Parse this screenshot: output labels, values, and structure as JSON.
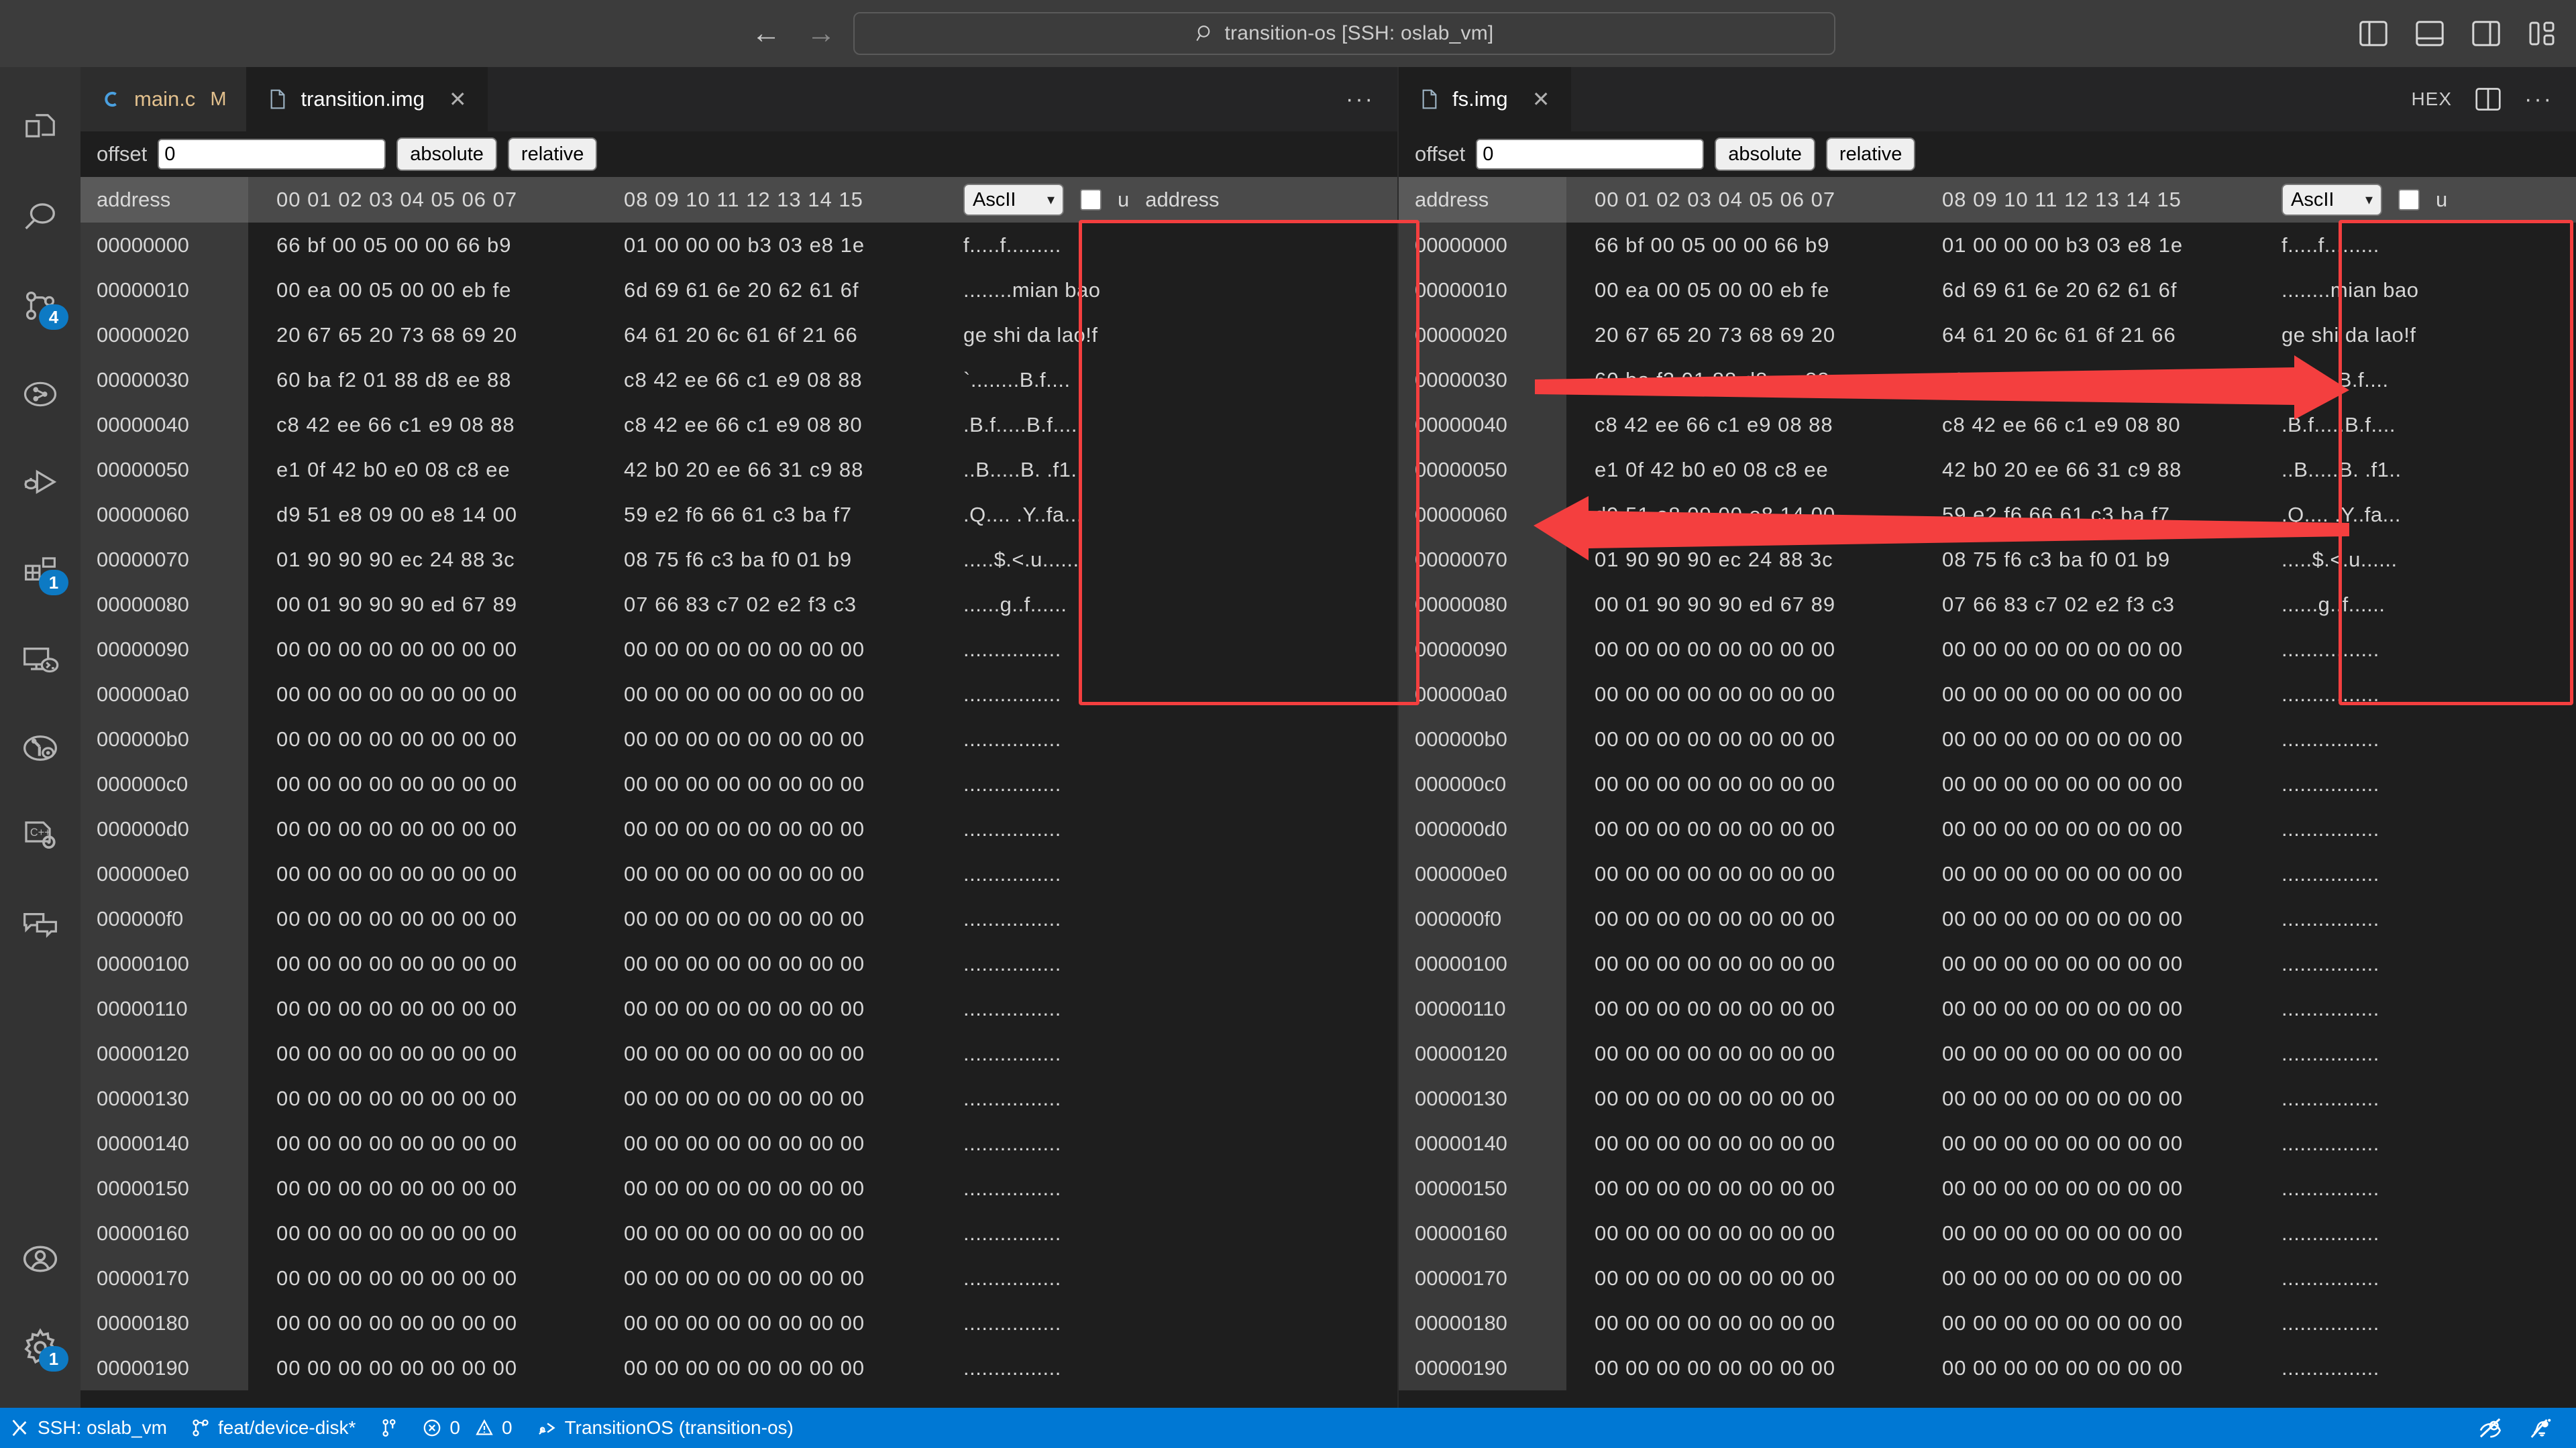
{
  "titlebar": {
    "back_label": "←",
    "forward_label": "→",
    "command_center_text": "transition-os [SSH: oslab_vm]",
    "layout_buttons": [
      {
        "name": "toggle-primary-sidebar",
        "label": "Toggle Primary Side Bar"
      },
      {
        "name": "toggle-panel",
        "label": "Toggle Panel"
      },
      {
        "name": "toggle-secondary-sidebar",
        "label": "Toggle Secondary Side Bar"
      },
      {
        "name": "customize-layout",
        "label": "Customize Layout"
      }
    ]
  },
  "activitybar": {
    "items": [
      {
        "name": "explorer",
        "label": "Explorer",
        "badge": ""
      },
      {
        "name": "search",
        "label": "Search",
        "badge": ""
      },
      {
        "name": "source-control",
        "label": "Source Control",
        "badge": "4"
      },
      {
        "name": "run",
        "label": "Run and Debug",
        "badge": ""
      },
      {
        "name": "debug-launch",
        "label": "Debug",
        "badge": ""
      },
      {
        "name": "extensions",
        "label": "Extensions",
        "badge": "1"
      },
      {
        "name": "remote-explorer",
        "label": "Remote Explorer",
        "badge": ""
      },
      {
        "name": "testing",
        "label": "Testing",
        "badge": ""
      },
      {
        "name": "cpp-config",
        "label": "C/C++ Configuration",
        "badge": ""
      },
      {
        "name": "chat",
        "label": "Chat",
        "badge": ""
      }
    ],
    "bottom_items": [
      {
        "name": "accounts",
        "label": "Accounts",
        "badge": ""
      },
      {
        "name": "settings",
        "label": "Manage",
        "badge": "1"
      }
    ]
  },
  "left_group": {
    "tabs": [
      {
        "name": "main-c",
        "label": "main.c",
        "badge": "M",
        "icon": "c-file-icon",
        "active": false,
        "closable": false
      },
      {
        "name": "transition-img",
        "label": "transition.img",
        "badge": "",
        "icon": "file-icon",
        "active": true,
        "closable": true
      }
    ],
    "actions": {
      "more": "···"
    },
    "offsetbar": {
      "label": "offset",
      "value": "0",
      "placeholder": "0",
      "absolute_label": "absolute",
      "relative_label": "relative"
    },
    "columns": {
      "address": "address",
      "hex_a": "00 01 02 03 04 05 06 07",
      "hex_b": "08 09 10 11 12 13 14 15",
      "encoding_selected": "AscII",
      "encoding_options": [
        "AscII"
      ],
      "unicode_checkbox_label": "u",
      "unicode_checked": false,
      "second_address_label": "address"
    }
  },
  "right_group": {
    "tabs": [
      {
        "name": "fs-img",
        "label": "fs.img",
        "badge": "",
        "icon": "file-icon",
        "active": true,
        "closable": true
      }
    ],
    "actions": {
      "hex": "HEX",
      "split": "split-editor-icon",
      "more": "···"
    },
    "offsetbar": {
      "label": "offset",
      "value": "0",
      "placeholder": "0",
      "absolute_label": "absolute",
      "relative_label": "relative"
    },
    "columns": {
      "address": "address",
      "hex_a": "00 01 02 03 04 05 06 07",
      "hex_b": "08 09 10 11 12 13 14 15",
      "encoding_selected": "AscII",
      "encoding_options": [
        "AscII"
      ],
      "unicode_checkbox_label": "u",
      "unicode_checked": false
    }
  },
  "hex_rows": [
    {
      "address": "00000000",
      "a": "66 bf 00 05 00 00 66 b9",
      "b": "01 00 00 00 b3 03 e8 1e",
      "ascii": "f.....f........."
    },
    {
      "address": "00000010",
      "a": "00 ea 00 05 00 00 eb fe",
      "b": "6d 69 61 6e 20 62 61 6f",
      "ascii": "........mian bao"
    },
    {
      "address": "00000020",
      "a": "20 67 65 20 73 68 69 20",
      "b": "64 61 20 6c 61 6f 21 66",
      "ascii": "ge shi da lao!f"
    },
    {
      "address": "00000030",
      "a": "60 ba f2 01 88 d8 ee 88",
      "b": "c8 42 ee 66 c1 e9 08 88",
      "ascii": "`........B.f...."
    },
    {
      "address": "00000040",
      "a": "c8 42 ee 66 c1 e9 08 88",
      "b": "c8 42 ee 66 c1 e9 08 80",
      "ascii": ".B.f.....B.f...."
    },
    {
      "address": "00000050",
      "a": "e1 0f 42 b0 e0 08 c8 ee",
      "b": "42 b0 20 ee 66 31 c9 88",
      "ascii": "..B.....B. .f1.."
    },
    {
      "address": "00000060",
      "a": "d9 51 e8 09 00 e8 14 00",
      "b": "59 e2 f6 66 61 c3 ba f7",
      "ascii": ".Q.... .Y..fa..."
    },
    {
      "address": "00000070",
      "a": "01 90 90 90 ec 24 88 3c",
      "b": "08 75 f6 c3 ba f0 01 b9",
      "ascii": ".....$.<.u......"
    },
    {
      "address": "00000080",
      "a": "00 01 90 90 90 ed 67 89",
      "b": "07 66 83 c7 02 e2 f3 c3",
      "ascii": "......g..f......"
    },
    {
      "address": "00000090",
      "a": "00 00 00 00 00 00 00 00",
      "b": "00 00 00 00 00 00 00 00",
      "ascii": "................"
    },
    {
      "address": "000000a0",
      "a": "00 00 00 00 00 00 00 00",
      "b": "00 00 00 00 00 00 00 00",
      "ascii": "................"
    },
    {
      "address": "000000b0",
      "a": "00 00 00 00 00 00 00 00",
      "b": "00 00 00 00 00 00 00 00",
      "ascii": "................"
    },
    {
      "address": "000000c0",
      "a": "00 00 00 00 00 00 00 00",
      "b": "00 00 00 00 00 00 00 00",
      "ascii": "................"
    },
    {
      "address": "000000d0",
      "a": "00 00 00 00 00 00 00 00",
      "b": "00 00 00 00 00 00 00 00",
      "ascii": "................"
    },
    {
      "address": "000000e0",
      "a": "00 00 00 00 00 00 00 00",
      "b": "00 00 00 00 00 00 00 00",
      "ascii": "................"
    },
    {
      "address": "000000f0",
      "a": "00 00 00 00 00 00 00 00",
      "b": "00 00 00 00 00 00 00 00",
      "ascii": "................"
    },
    {
      "address": "00000100",
      "a": "00 00 00 00 00 00 00 00",
      "b": "00 00 00 00 00 00 00 00",
      "ascii": "................"
    },
    {
      "address": "00000110",
      "a": "00 00 00 00 00 00 00 00",
      "b": "00 00 00 00 00 00 00 00",
      "ascii": "................"
    },
    {
      "address": "00000120",
      "a": "00 00 00 00 00 00 00 00",
      "b": "00 00 00 00 00 00 00 00",
      "ascii": "................"
    },
    {
      "address": "00000130",
      "a": "00 00 00 00 00 00 00 00",
      "b": "00 00 00 00 00 00 00 00",
      "ascii": "................"
    },
    {
      "address": "00000140",
      "a": "00 00 00 00 00 00 00 00",
      "b": "00 00 00 00 00 00 00 00",
      "ascii": "................"
    },
    {
      "address": "00000150",
      "a": "00 00 00 00 00 00 00 00",
      "b": "00 00 00 00 00 00 00 00",
      "ascii": "................"
    },
    {
      "address": "00000160",
      "a": "00 00 00 00 00 00 00 00",
      "b": "00 00 00 00 00 00 00 00",
      "ascii": "................"
    },
    {
      "address": "00000170",
      "a": "00 00 00 00 00 00 00 00",
      "b": "00 00 00 00 00 00 00 00",
      "ascii": "................"
    },
    {
      "address": "00000180",
      "a": "00 00 00 00 00 00 00 00",
      "b": "00 00 00 00 00 00 00 00",
      "ascii": "................"
    },
    {
      "address": "00000190",
      "a": "00 00 00 00 00 00 00 00",
      "b": "00 00 00 00 00 00 00 00",
      "ascii": "................"
    }
  ],
  "annotations": {
    "accent_color": "#f43f3f",
    "left_box": {
      "name": "highlight-box-left-ascii"
    },
    "right_box": {
      "name": "highlight-box-right-ascii"
    },
    "arrow_right": {
      "name": "arrow-left-to-right"
    },
    "arrow_left": {
      "name": "arrow-right-to-left"
    }
  },
  "statusbar": {
    "remote_label": "SSH: oslab_vm",
    "branch_label": "feat/device-disk*",
    "sync_label": "",
    "errors_label": "0",
    "warnings_label": "0",
    "project_label": "TransitionOS (transition-os)",
    "background_color": "#0078d4"
  }
}
